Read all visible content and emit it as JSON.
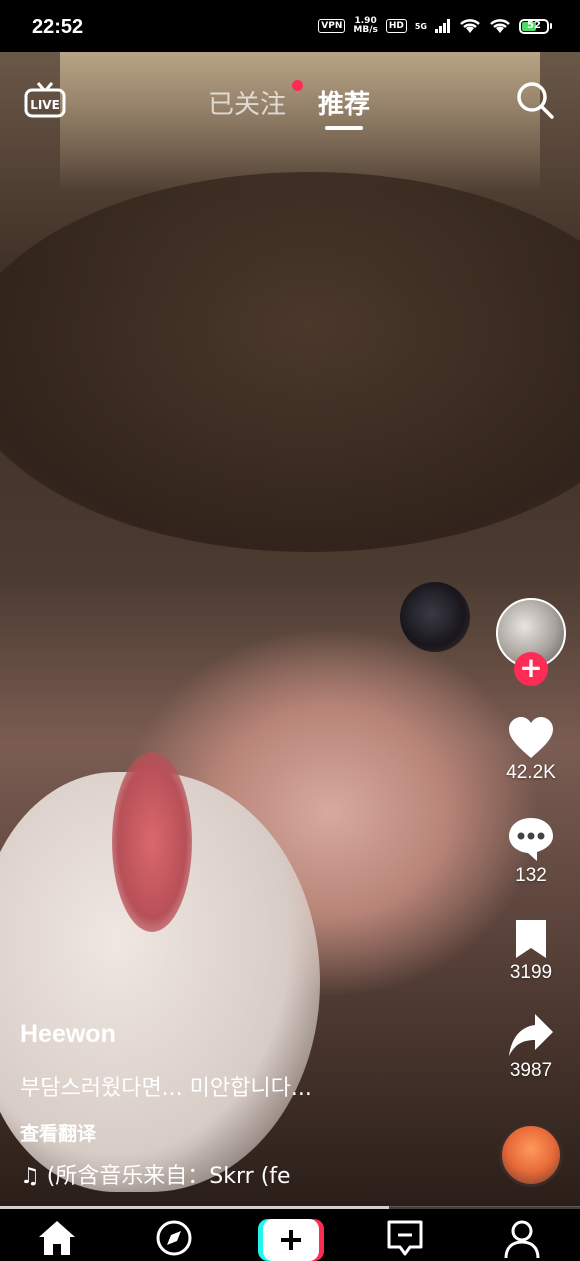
{
  "status_bar": {
    "time": "22:52",
    "vpn": "VPN",
    "speed_value": "1.90",
    "speed_unit": "MB/s",
    "hd": "HD",
    "network": "5G",
    "battery": "52"
  },
  "top_nav": {
    "live_label": "LIVE",
    "tabs": [
      {
        "label": "已关注",
        "active": false,
        "has_dot": true
      },
      {
        "label": "推荐",
        "active": true
      }
    ]
  },
  "video": {
    "author": "Heewon",
    "description": "부담스러웠다면... 미안합니다...",
    "translate_label": "查看翻译",
    "music_text": "♫ (所含音乐来自：Skrr (fe",
    "progress": 0.67
  },
  "actions": {
    "likes": "42.2K",
    "comments": "132",
    "favorites": "3199",
    "shares": "3987"
  },
  "colors": {
    "accent": "#fe2c55",
    "battery_fill": "#4cd964"
  }
}
